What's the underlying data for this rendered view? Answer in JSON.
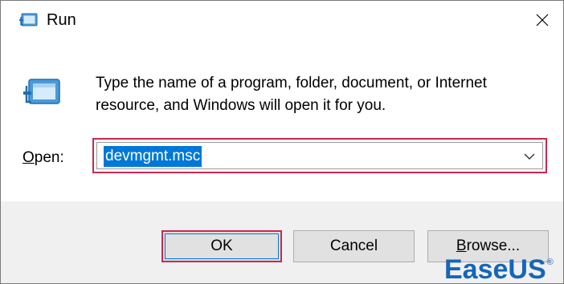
{
  "window": {
    "title": "Run",
    "icons": {
      "title": "run-icon",
      "close": "close-icon",
      "run_big": "run-icon"
    }
  },
  "content": {
    "description_line1": "Type the name of a program, folder, document, or Internet",
    "description_line2": "resource, and Windows will open it for you.",
    "open_label_mnemonic": "O",
    "open_label_rest": "pen:",
    "open_value": "devmgmt.msc",
    "dropdown_icon": "chevron-down-icon"
  },
  "buttons": {
    "ok": "OK",
    "cancel": "Cancel",
    "browse_mnemonic": "B",
    "browse_rest": "rowse..."
  },
  "watermark": {
    "text_part1": "Ease",
    "text_part2": "US",
    "registered": "®"
  },
  "colors": {
    "highlight_border": "#c9284f",
    "selection": "#0078d7",
    "footer_bg": "#f0f0f0",
    "button_bg": "#e1e1e1",
    "watermark": "#1566b8"
  }
}
